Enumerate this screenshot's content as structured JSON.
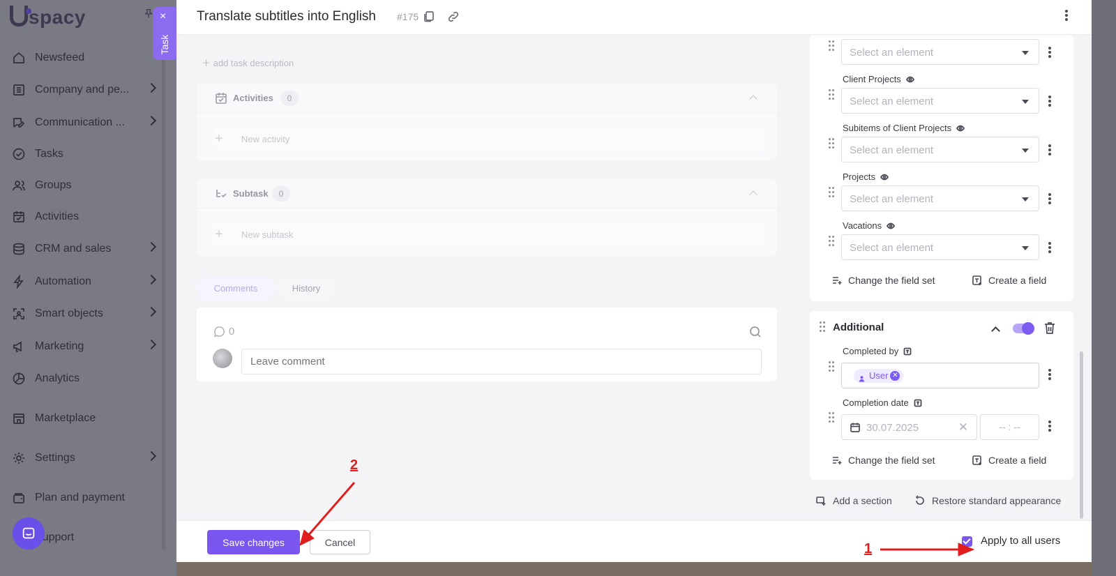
{
  "app": {
    "logo_text": "spacy"
  },
  "sidebar": {
    "items": [
      {
        "label": "Newsfeed",
        "icon": "home-icon",
        "has_chevron": false
      },
      {
        "label": "Company and pe...",
        "icon": "building-icon",
        "has_chevron": true
      },
      {
        "label": "Communication ...",
        "icon": "chat-edit-icon",
        "has_chevron": true
      },
      {
        "label": "Tasks",
        "icon": "check-circle-icon",
        "has_chevron": false
      },
      {
        "label": "Groups",
        "icon": "users-icon",
        "has_chevron": false
      },
      {
        "label": "Activities",
        "icon": "calendar-check-icon",
        "has_chevron": false
      },
      {
        "label": "CRM and sales",
        "icon": "coins-icon",
        "has_chevron": true
      },
      {
        "label": "Automation",
        "icon": "lightning-icon",
        "has_chevron": true
      },
      {
        "label": "Smart objects",
        "icon": "scan-icon",
        "has_chevron": true
      },
      {
        "label": "Marketing",
        "icon": "megaphone-icon",
        "has_chevron": true
      },
      {
        "label": "Analytics",
        "icon": "pie-chart-icon",
        "has_chevron": false
      },
      {
        "label": "Marketplace",
        "icon": "store-icon",
        "has_chevron": false
      },
      {
        "label": "Settings",
        "icon": "gear-icon",
        "has_chevron": true
      },
      {
        "label": "Plan and payment",
        "icon": "wallet-icon",
        "has_chevron": false
      },
      {
        "label": "Support",
        "icon": "help-icon",
        "has_chevron": false
      }
    ]
  },
  "task_tab": {
    "label": "Task",
    "close": "×"
  },
  "task": {
    "title": "Translate subtitles into English",
    "number": "#175",
    "add_description": "add task description",
    "activities": {
      "label": "Activities",
      "count": "0",
      "new_placeholder": "New activity"
    },
    "subtask": {
      "label": "Subtask",
      "count": "0",
      "new_placeholder": "New subtask"
    },
    "tabs": [
      {
        "label": "Comments",
        "active": true
      },
      {
        "label": "History",
        "active": false
      }
    ],
    "comments": {
      "count": "0",
      "placeholder": "Leave comment"
    }
  },
  "fields": {
    "select_placeholder": "Select an element",
    "list": [
      {
        "label": ""
      },
      {
        "label": "Client Projects"
      },
      {
        "label": "Subitems of Client Projects"
      },
      {
        "label": "Projects"
      },
      {
        "label": "Vacations"
      }
    ],
    "change_field_set": "Change the field set",
    "create_field": "Create a field"
  },
  "additional": {
    "title": "Additional",
    "toggle_on": true,
    "completed_by": {
      "label": "Completed by",
      "chip": "User"
    },
    "completion_date": {
      "label": "Completion date",
      "date": "30.07.2025",
      "time": "-- : --"
    },
    "change_field_set": "Change the field set",
    "create_field": "Create a field"
  },
  "bottom_links": {
    "add_section": "Add a section",
    "restore": "Restore standard appearance"
  },
  "footer": {
    "save_label": "Save changes",
    "cancel_label": "Cancel",
    "apply_label": "Apply to all users",
    "apply_checked": true
  },
  "annotations": {
    "marker_1": "1",
    "marker_2": "2",
    "arrow_color": "#e01e1e"
  },
  "colors": {
    "accent": "#7a55f0",
    "annotation": "#e01e1e"
  }
}
